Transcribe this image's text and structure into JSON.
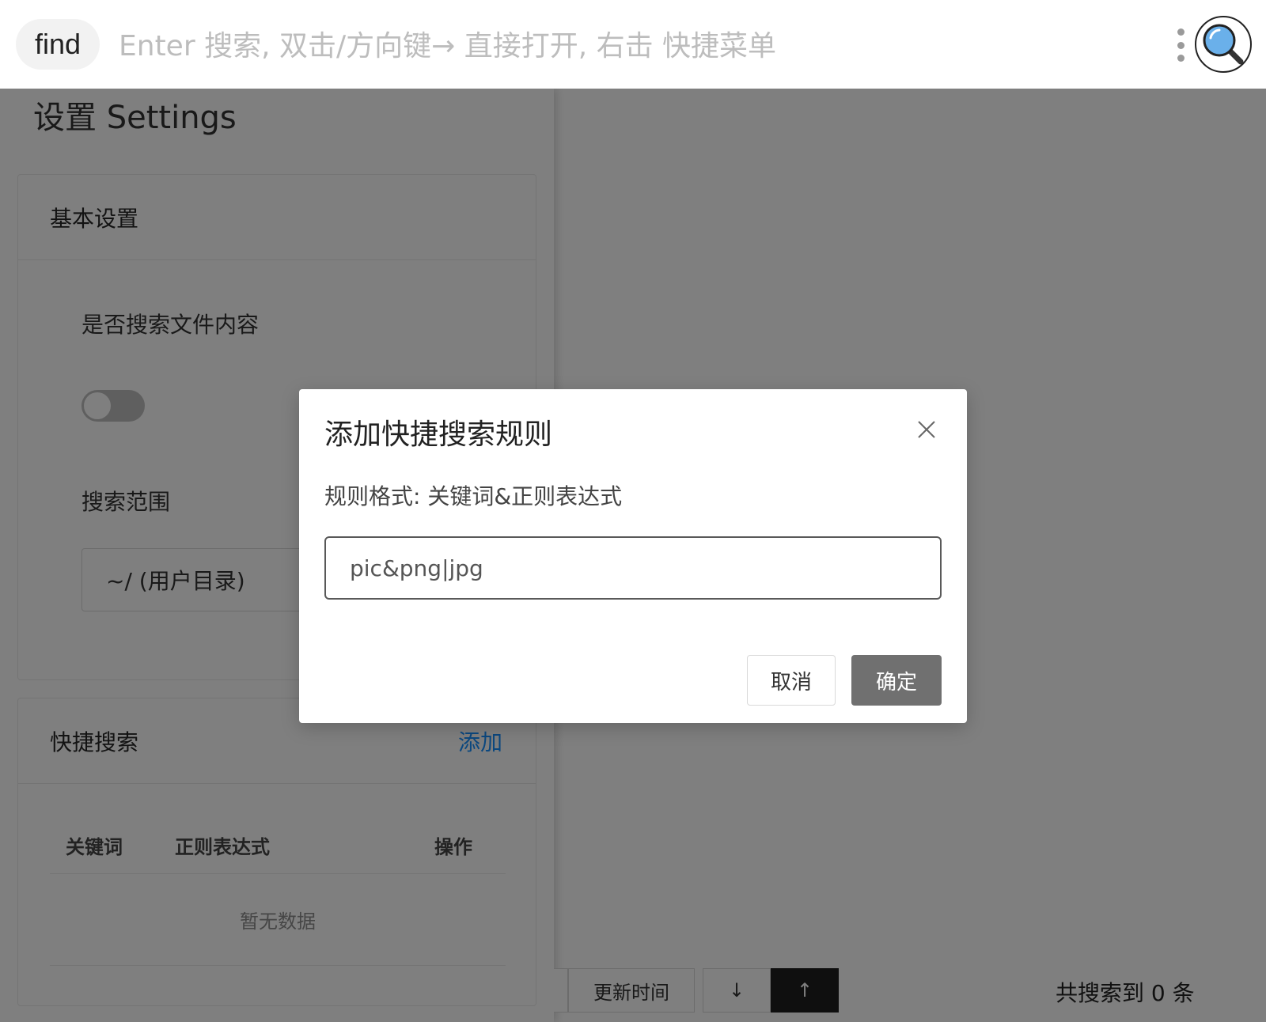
{
  "topbar": {
    "mode_label": "find",
    "search_placeholder": "Enter 搜索, 双击/方向键→ 直接打开, 右击 快捷菜单"
  },
  "settings": {
    "title": "设置 Settings",
    "basic": {
      "header": "基本设置",
      "search_content_label": "是否搜索文件内容",
      "scope_label": "搜索范围",
      "scope_value": "~/ (用户目录)"
    },
    "quick": {
      "header": "快捷搜索",
      "add_label": "添加",
      "columns": [
        "关键词",
        "正则表达式",
        "操作"
      ],
      "empty_text": "暂无数据"
    }
  },
  "sortbar": {
    "update_time_label": "更新时间",
    "desc_label": "↓",
    "asc_label": "↑",
    "result_count": "共搜索到 0 条"
  },
  "modal": {
    "title": "添加快捷搜索规则",
    "hint": "规则格式: 关键词&正则表达式",
    "input_value": "pic&png|jpg",
    "cancel_label": "取消",
    "ok_label": "确定"
  },
  "colors": {
    "accent": "#1890ff",
    "mask": "rgba(0,0,0,0.5)",
    "primary_button": "#707070"
  },
  "icons": {
    "search": "magnifier-icon",
    "menu": "kebab-menu-icon",
    "close": "close-icon"
  }
}
